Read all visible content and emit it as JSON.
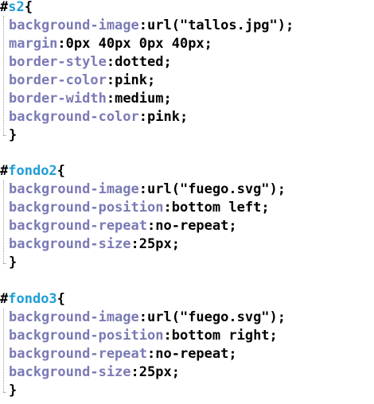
{
  "blocks": [
    {
      "selector_hash": "#",
      "selector_name": "s2",
      "open_brace": "{",
      "close_brace": "}",
      "declarations": [
        {
          "property": "background-image",
          "value": "url(\"tallos.jpg\")"
        },
        {
          "property": "margin",
          "value": "0px 40px 0px 40px"
        },
        {
          "property": "border-style",
          "value": "dotted"
        },
        {
          "property": "border-color",
          "value": "pink"
        },
        {
          "property": "border-width",
          "value": "medium"
        },
        {
          "property": "background-color",
          "value": "pink"
        }
      ]
    },
    {
      "selector_hash": "#",
      "selector_name": "fondo2",
      "open_brace": "{",
      "close_brace": "}",
      "declarations": [
        {
          "property": "background-image",
          "value": "url(\"fuego.svg\")"
        },
        {
          "property": "background-position",
          "value": "bottom left"
        },
        {
          "property": "background-repeat",
          "value": "no-repeat"
        },
        {
          "property": "background-size",
          "value": "25px"
        }
      ]
    },
    {
      "selector_hash": "#",
      "selector_name": "fondo3",
      "open_brace": "{",
      "close_brace": "}",
      "declarations": [
        {
          "property": "background-image",
          "value": "url(\"fuego.svg\")"
        },
        {
          "property": "background-position",
          "value": "bottom right"
        },
        {
          "property": "background-repeat",
          "value": "no-repeat"
        },
        {
          "property": "background-size",
          "value": "25px"
        }
      ]
    }
  ],
  "syntax": {
    "colon": ":",
    "semicolon": ";"
  },
  "colors": {
    "selector": "#1e9ed8",
    "property": "#7a7ab6",
    "value": "#000000",
    "fold_guide": "#9a9a9a"
  }
}
